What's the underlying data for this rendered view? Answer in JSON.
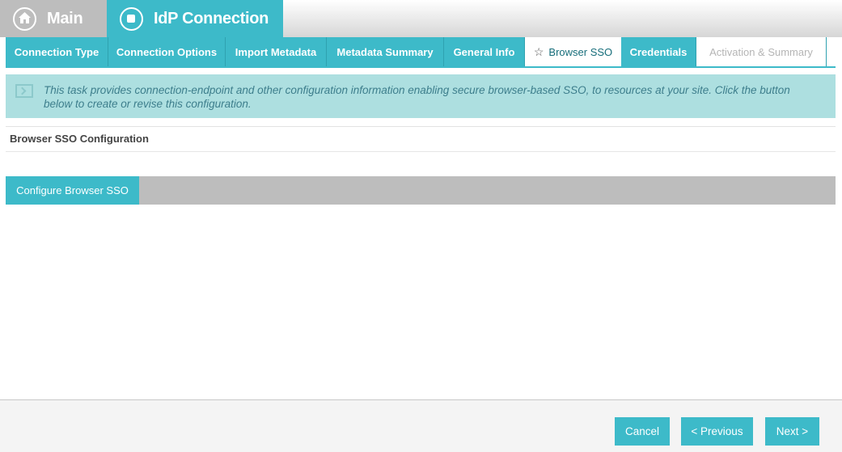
{
  "header": {
    "main_tab": {
      "label": "Main",
      "icon": "home-icon"
    },
    "idp_tab": {
      "label": "IdP Connection",
      "icon": "stop-icon"
    }
  },
  "wizard_tabs": [
    {
      "label": "Connection Type",
      "state": "default"
    },
    {
      "label": "Connection Options",
      "state": "default"
    },
    {
      "label": "Import Metadata",
      "state": "default"
    },
    {
      "label": "Metadata Summary",
      "state": "default"
    },
    {
      "label": "General Info",
      "state": "default"
    },
    {
      "label": "Browser SSO",
      "state": "active",
      "icon": "star-icon"
    },
    {
      "label": "Credentials",
      "state": "default"
    },
    {
      "label": "Activation & Summary",
      "state": "disabled"
    }
  ],
  "info": {
    "text": "This task provides connection-endpoint and other configuration information enabling secure browser-based SSO, to resources at your site. Click the button below to create or revise this configuration.",
    "icon": "info-panel-icon"
  },
  "section": {
    "title": "Browser SSO Configuration"
  },
  "configure_button": {
    "label": "Configure Browser SSO"
  },
  "footer": {
    "cancel_label": "Cancel",
    "previous_label": "< Previous",
    "next_label": "Next >"
  },
  "colors": {
    "accent": "#3dbac9",
    "info_bg": "#addfe0",
    "inactive_gray": "#bdbdbd"
  }
}
